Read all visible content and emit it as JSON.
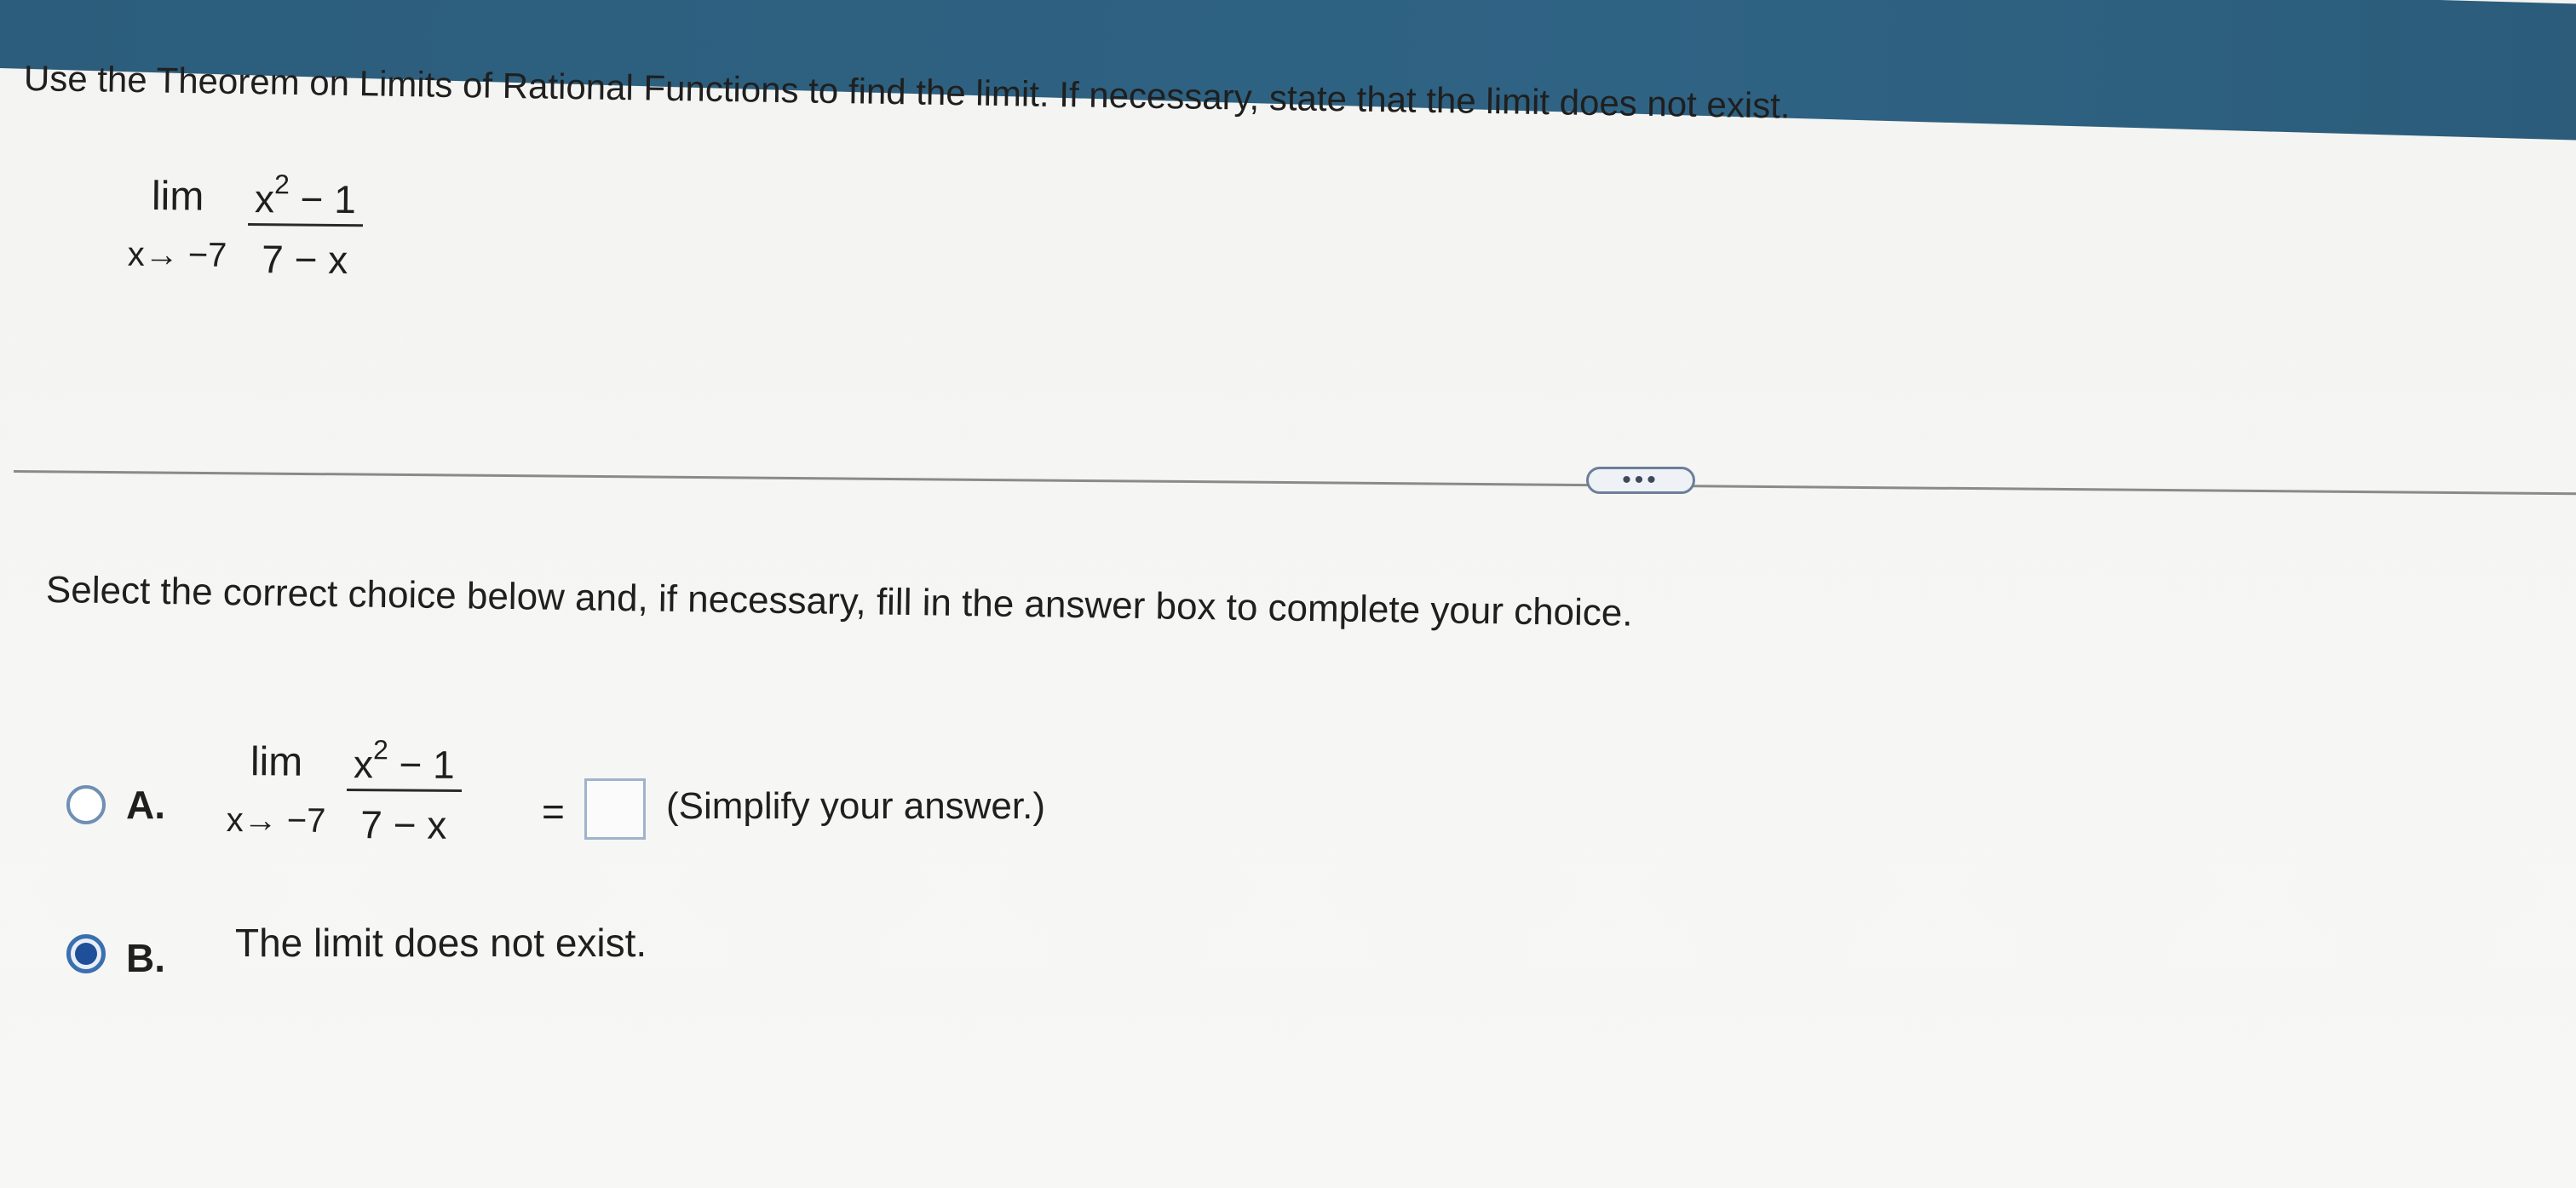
{
  "question": {
    "prompt": "Use the Theorem on Limits of Rational Functions to find the limit. If necessary, state that the limit does not exist.",
    "limit": {
      "lim_word": "lim",
      "approach": "x→ −7",
      "numerator_base": "x",
      "numerator_exp": "2",
      "numerator_rest": " − 1",
      "denominator": "7 − x"
    }
  },
  "more_button": {
    "label": "•••"
  },
  "instruction": "Select the correct choice below and, if necessary, fill in the answer box to complete your choice.",
  "choices": {
    "a": {
      "letter": "A.",
      "lim_word": "lim",
      "approach": "x→ −7",
      "numerator_base": "x",
      "numerator_exp": "2",
      "numerator_rest": " − 1",
      "denominator": "7 − x",
      "equals": "=",
      "answer_value": "",
      "note": "(Simplify your answer.)",
      "selected": false
    },
    "b": {
      "letter": "B.",
      "text": "The limit does not exist.",
      "selected": true
    }
  },
  "colors": {
    "top_band": "#2c5d7c",
    "radio_border": "#6f8fb3",
    "radio_selected_dot": "#1f4f98",
    "answer_box_border": "#9fb3cc"
  }
}
